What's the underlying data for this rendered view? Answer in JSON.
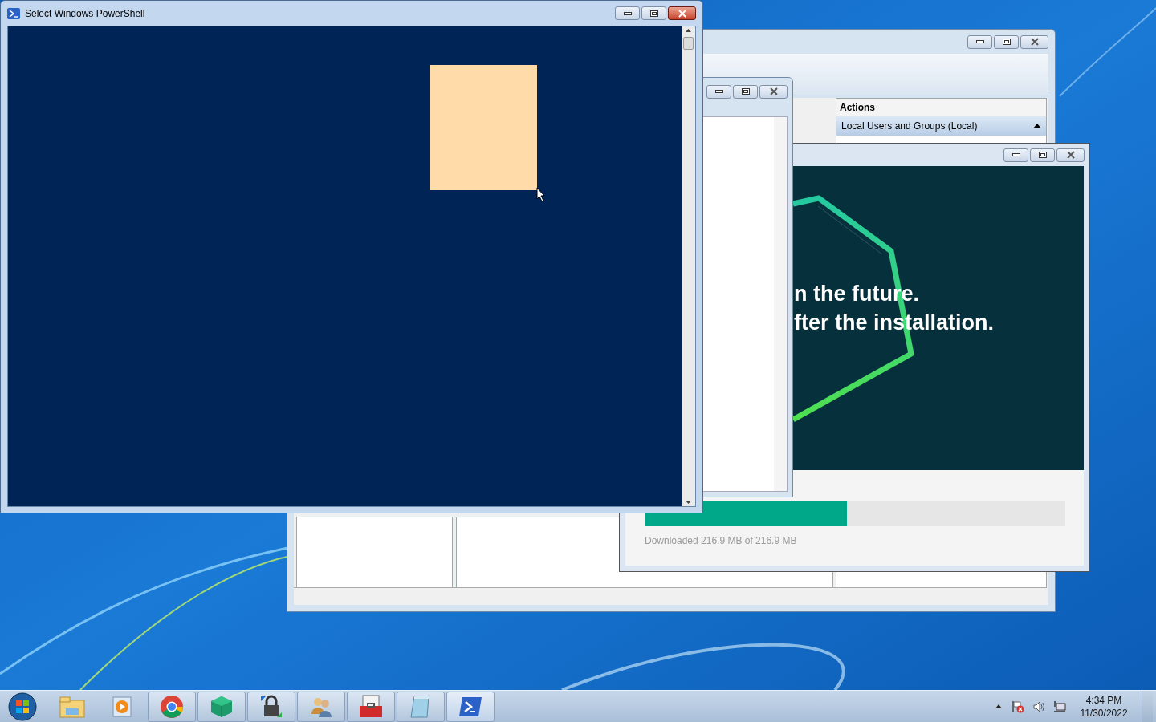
{
  "powershell_window": {
    "title": "Select Windows PowerShell"
  },
  "mmc_window": {
    "actions": {
      "header": "Actions",
      "section": "Local Users and Groups (Local)"
    }
  },
  "installer_window": {
    "banner_lines": [
      "n the future.",
      "fter the installation."
    ],
    "progress": {
      "level": 0.48,
      "caption": "Downloaded 216.9 MB of 216.9 MB"
    }
  },
  "taskbar": {
    "clock": {
      "time": "4:34 PM",
      "date": "11/30/2022"
    }
  }
}
